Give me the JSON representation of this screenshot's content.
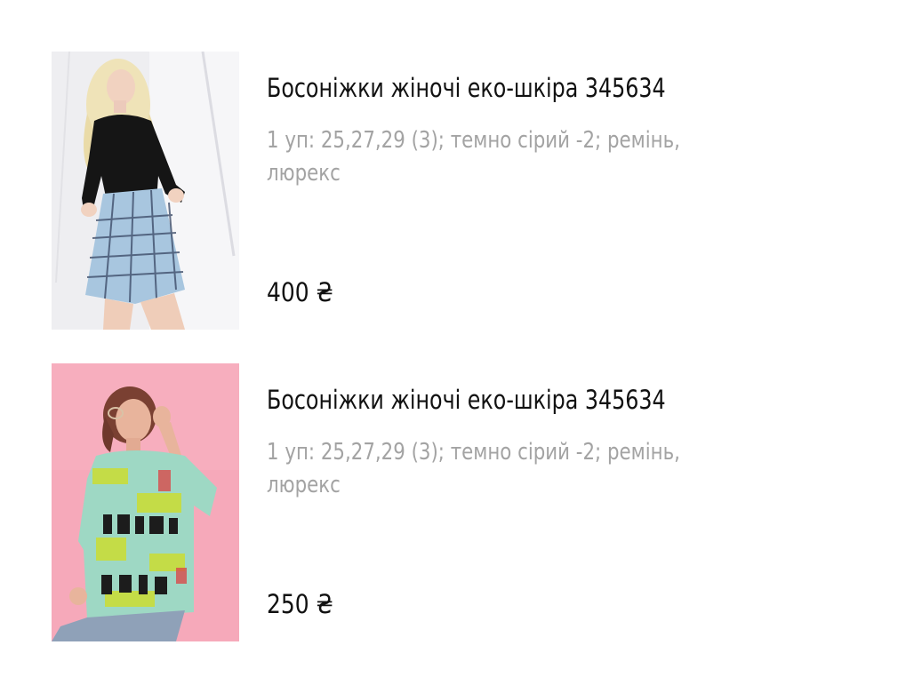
{
  "products": [
    {
      "title": "Босоніжки жіночі еко-шкіра 345634",
      "description": "1 уп: 25,27,29 (3); темно сірий -2; ремінь, люрекс",
      "price": "400 ₴",
      "image_label": "Фото товару"
    },
    {
      "title": "Босоніжки жіночі еко-шкіра 345634",
      "description": "1 уп: 25,27,29 (3); темно сірий -2; ремінь, люрекс",
      "price": "250 ₴",
      "image_label": "Фото товару"
    }
  ],
  "colors": {
    "title": "#111111",
    "description": "#a3a3a3",
    "photo1_background": "#eeeef0",
    "photo2_background": "#f6a8b8"
  }
}
